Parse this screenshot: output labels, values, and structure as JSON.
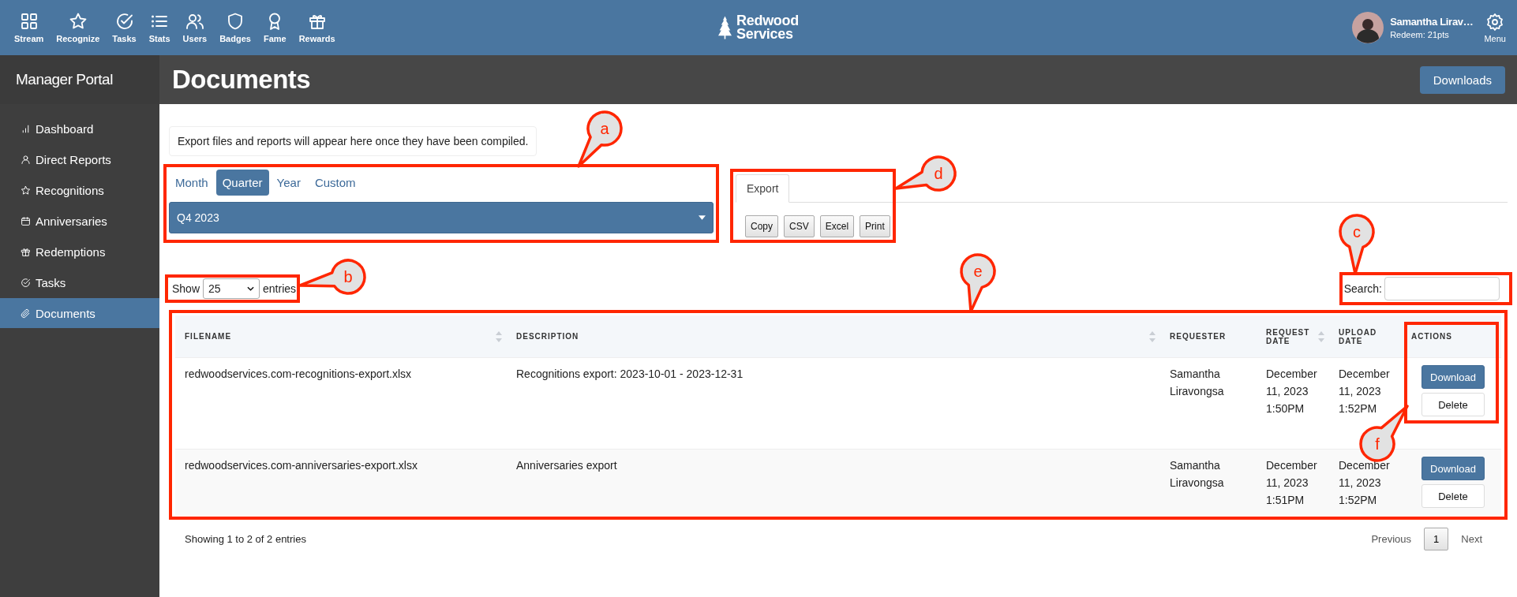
{
  "top_nav": {
    "items": [
      {
        "label": "Stream"
      },
      {
        "label": "Recognize"
      },
      {
        "label": "Tasks"
      },
      {
        "label": "Stats"
      },
      {
        "label": "Users"
      },
      {
        "label": "Badges"
      },
      {
        "label": "Fame"
      },
      {
        "label": "Rewards"
      }
    ]
  },
  "logo": {
    "line_1": "Redwood",
    "line_2": "Services"
  },
  "user": {
    "name": "Samantha Lirav…",
    "points": "Redeem: 21pts"
  },
  "menu_button": {
    "label": "Menu"
  },
  "sidebar": {
    "title": "Manager Portal",
    "items": [
      {
        "label": "Dashboard",
        "selected": false
      },
      {
        "label": "Direct Reports",
        "selected": false
      },
      {
        "label": "Recognitions",
        "selected": false
      },
      {
        "label": "Anniversaries",
        "selected": false
      },
      {
        "label": "Redemptions",
        "selected": false
      },
      {
        "label": "Tasks",
        "selected": false
      },
      {
        "label": "Documents",
        "selected": true
      }
    ]
  },
  "page": {
    "title": "Documents",
    "downloads_button": "Downloads"
  },
  "notice": "Export files and reports will appear here once they have been compiled.",
  "period": {
    "tabs": [
      {
        "label": "Month",
        "selected": false
      },
      {
        "label": "Quarter",
        "selected": true
      },
      {
        "label": "Year",
        "selected": false
      },
      {
        "label": "Custom",
        "selected": false
      }
    ],
    "select_value": "Q4 2023"
  },
  "export": {
    "tab": "Export",
    "buttons": [
      "Copy",
      "CSV",
      "Excel",
      "Print"
    ]
  },
  "table_controls": {
    "show_label": "Show",
    "page_length": "25",
    "entries_label": "entries",
    "search_label": "Search:"
  },
  "table": {
    "columns": [
      {
        "label": "FILENAME",
        "sortable": true
      },
      {
        "label": "DESCRIPTION",
        "sortable": true
      },
      {
        "label": "REQUESTER",
        "sortable": false
      },
      {
        "label": "REQUEST DATE",
        "sortable": true
      },
      {
        "label": "UPLOAD DATE",
        "sortable": false
      },
      {
        "label": "ACTIONS",
        "sortable": false
      }
    ],
    "rows": [
      {
        "filename": "redwoodservices.com-recognitions-export.xlsx",
        "description": "Recognitions export: 2023-10-01 - 2023-12-31",
        "requester": "Samantha Liravongsa",
        "request_date": "December 11, 2023 1:50PM",
        "upload_date": "December 11, 2023 1:52PM",
        "actions": [
          "Download",
          "Delete"
        ]
      },
      {
        "filename": "redwoodservices.com-anniversaries-export.xlsx",
        "description": "Anniversaries export",
        "requester": "Samantha Liravongsa",
        "request_date": "December 11, 2023 1:51PM",
        "upload_date": "December 11, 2023 1:52PM",
        "actions": [
          "Download",
          "Delete"
        ]
      }
    ]
  },
  "footer": {
    "info": "Showing 1 to 2 of 2 entries",
    "previous": "Previous",
    "pages": [
      {
        "label": "1",
        "selected": true
      }
    ],
    "next": "Next"
  },
  "annotations": [
    {
      "label": "a"
    },
    {
      "label": "b"
    },
    {
      "label": "c"
    },
    {
      "label": "d"
    },
    {
      "label": "e"
    },
    {
      "label": "f"
    }
  ]
}
